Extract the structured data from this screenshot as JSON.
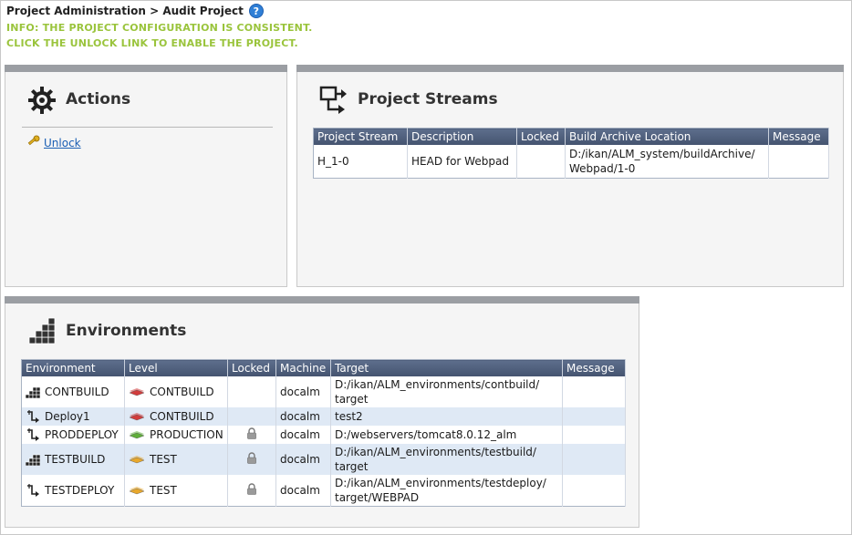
{
  "header": {
    "breadcrumb": "Project Administration > Audit Project",
    "help_icon": "help-icon",
    "help_glyph": "?"
  },
  "info": {
    "line1": "INFO: THE PROJECT CONFIGURATION IS CONSISTENT.",
    "line2": "CLICK THE UNLOCK LINK TO ENABLE THE PROJECT."
  },
  "actions": {
    "title": "Actions",
    "icon": "gear-icon",
    "unlock_label": "Unlock",
    "unlock_icon": "key-icon"
  },
  "streams": {
    "title": "Project Streams",
    "icon": "streams-icon",
    "columns": [
      "Project Stream",
      "Description",
      "Locked",
      "Build Archive Location",
      "Message"
    ],
    "rows": [
      {
        "stream": "H_1-0",
        "description": "HEAD for Webpad",
        "locked": "",
        "location_line1": "D:/ikan/ALM_system/buildArchive/",
        "location_line2": "Webpad/1-0",
        "message": ""
      }
    ]
  },
  "environments": {
    "title": "Environments",
    "icon": "environments-icon",
    "columns": [
      "Environment",
      "Level",
      "Locked",
      "Machine",
      "Target",
      "Message"
    ],
    "rows": [
      {
        "environment": "CONTBUILD",
        "env_type": "build",
        "level": "CONTBUILD",
        "level_color": "#d23c3c",
        "locked": false,
        "machine": "docalm",
        "target_line1": "D:/ikan/ALM_environments/contbuild/",
        "target_line2": "target",
        "message": ""
      },
      {
        "environment": "Deploy1",
        "env_type": "deploy",
        "level": "CONTBUILD",
        "level_color": "#d23c3c",
        "locked": false,
        "machine": "docalm",
        "target_line1": "test2",
        "target_line2": "",
        "message": ""
      },
      {
        "environment": "PRODDEPLOY",
        "env_type": "deploy",
        "level": "PRODUCTION",
        "level_color": "#5fae3a",
        "locked": true,
        "machine": "docalm",
        "target_line1": "D:/webservers/tomcat8.0.12_alm",
        "target_line2": "",
        "message": ""
      },
      {
        "environment": "TESTBUILD",
        "env_type": "build",
        "level": "TEST",
        "level_color": "#e8a82c",
        "locked": true,
        "machine": "docalm",
        "target_line1": "D:/ikan/ALM_environments/testbuild/",
        "target_line2": "target",
        "message": ""
      },
      {
        "environment": "TESTDEPLOY",
        "env_type": "deploy",
        "level": "TEST",
        "level_color": "#e8a82c",
        "locked": true,
        "machine": "docalm",
        "target_line1": "D:/ikan/ALM_environments/testdeploy/",
        "target_line2": "target/WEBPAD",
        "message": ""
      }
    ]
  }
}
